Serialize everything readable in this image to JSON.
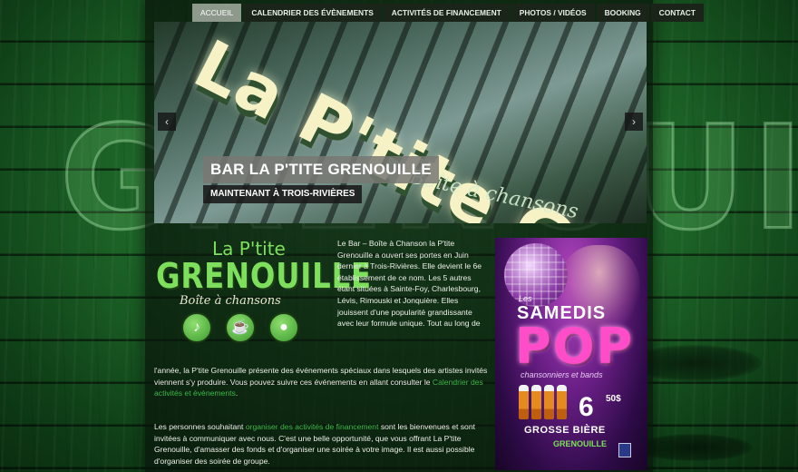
{
  "background": {
    "word": "GRENOUILLE"
  },
  "nav": {
    "items": [
      {
        "label": "Accueil",
        "active": true
      },
      {
        "label": "Calendrier des évènements",
        "active": false
      },
      {
        "label": "Activités de financement",
        "active": false
      },
      {
        "label": "Photos / Vidéos",
        "active": false
      },
      {
        "label": "Booking",
        "active": false
      },
      {
        "label": "Contact",
        "active": false
      }
    ]
  },
  "slider": {
    "sign_text": "La P'tite GRENOUILLE",
    "sign_sub": "Boîte à chansons",
    "caption_title": "BAR LA P'TITE GRENOUILLE",
    "caption_sub": "MAINTENANT À TROIS-RIVIÈRES",
    "prev_icon": "‹",
    "next_icon": "›"
  },
  "logo": {
    "top": "La P'tite",
    "main": "GRENOUILLE",
    "sub": "Boîte à chansons",
    "icons": [
      "guitar-icon",
      "beer-icon",
      "microphone-icon"
    ]
  },
  "content": {
    "intro": "Le Bar – Boîte à Chanson la P'tite Grenouille a ouvert ses portes en Juin dernier à Trois-Rivières.  Elle devient le 6e établissement de ce nom.  Les 5 autres étant situées à Sainte-Foy, Charlesbourg, Lévis, Rimouski et Jonquière.  Elles jouissent d'une popularité grandissante avec leur formule unique. Tout au long de",
    "p2_before": "l'année, la P'tite Grenouille présente des événements spéciaux dans lesquels des artistes invités viennent s'y produire. Vous pouvez suivre ces événements en allant consulter le ",
    "p2_link": "Calendrier des activités et évènements",
    "p2_after": ".",
    "p3_before": "Les personnes souhaitant ",
    "p3_link": "organiser des activités de financement",
    "p3_after": " sont les bienvenues et sont invitées à communiquer avec nous.  C'est une belle opportunité, que vous offrant La P'tite Grenouille, d'amasser des fonds et d'organiser une soirée à votre image. Il est aussi possible d'organiser des soirée de groupe."
  },
  "ad": {
    "les": "Les",
    "samedis": "SAMEDIS",
    "pop": "POP",
    "chansonniers": "chansonniers et bands",
    "price": "6",
    "price_cents": "50$",
    "grosse": "GROSSE BIÈRE",
    "logo": "GRENOUILLE"
  },
  "colors": {
    "accent_green": "#7ddf5c",
    "link_green": "#3bb84a",
    "nav_bg": "#1b2419",
    "nav_active": "#8d9a8b"
  }
}
